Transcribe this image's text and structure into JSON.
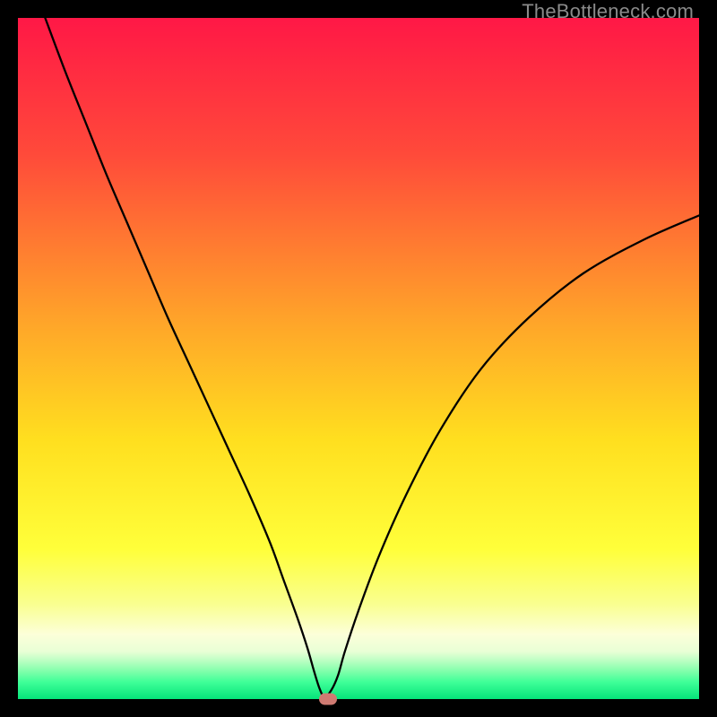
{
  "watermark": {
    "text": "TheBottleneck.com"
  },
  "chart_data": {
    "type": "line",
    "title": "",
    "xlabel": "",
    "ylabel": "",
    "xlim": [
      0,
      100
    ],
    "ylim": [
      0,
      100
    ],
    "grid": false,
    "gradient_stops": [
      {
        "offset": 0.0,
        "color": "#ff1846"
      },
      {
        "offset": 0.2,
        "color": "#ff4a3a"
      },
      {
        "offset": 0.45,
        "color": "#ffa629"
      },
      {
        "offset": 0.62,
        "color": "#ffdf1f"
      },
      {
        "offset": 0.78,
        "color": "#ffff3a"
      },
      {
        "offset": 0.86,
        "color": "#f9ff8f"
      },
      {
        "offset": 0.905,
        "color": "#fcffd9"
      },
      {
        "offset": 0.93,
        "color": "#e9ffd6"
      },
      {
        "offset": 0.945,
        "color": "#b7ffc1"
      },
      {
        "offset": 0.96,
        "color": "#7dffaa"
      },
      {
        "offset": 0.975,
        "color": "#3fff98"
      },
      {
        "offset": 1.0,
        "color": "#05e47a"
      }
    ],
    "series": [
      {
        "name": "bottleneck-curve",
        "color": "#000000",
        "width": 2.3,
        "x": [
          4,
          7,
          10,
          13,
          16,
          19,
          22,
          25,
          28,
          31,
          34,
          37,
          39,
          41,
          42.5,
          43.5,
          44.3,
          45,
          46,
          47,
          48,
          50,
          53,
          57,
          62,
          68,
          75,
          83,
          92,
          100
        ],
        "y": [
          100,
          92,
          84.5,
          77,
          70,
          63,
          56,
          49.5,
          43,
          36.5,
          30,
          23,
          17.5,
          12,
          7.5,
          4,
          1.5,
          0.3,
          1.3,
          3.5,
          7,
          13,
          21,
          30,
          39.5,
          48.5,
          56,
          62.5,
          67.5,
          71
        ]
      }
    ],
    "marker": {
      "x": 45.5,
      "y": 0,
      "color": "#cf7a72"
    }
  }
}
